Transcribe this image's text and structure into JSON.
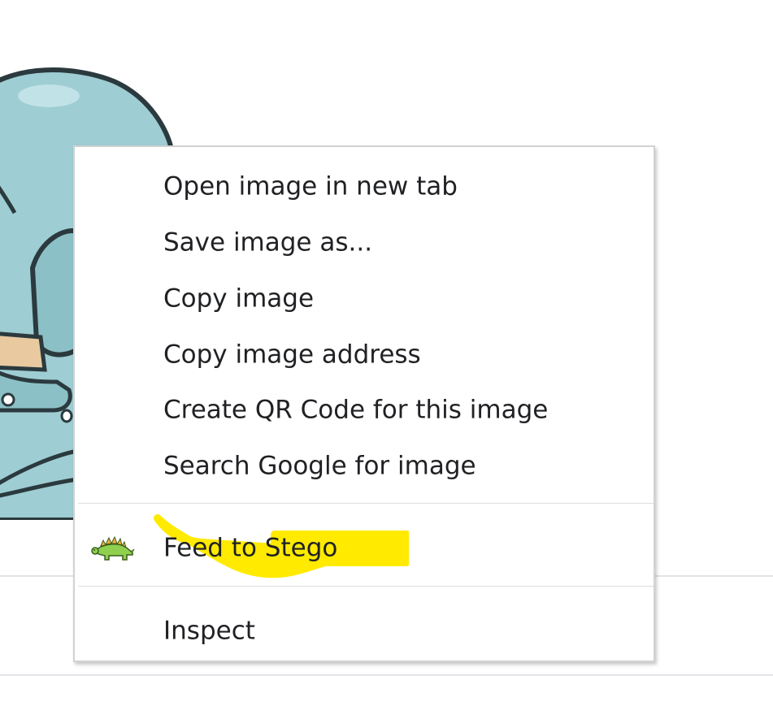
{
  "context_menu": {
    "items": [
      {
        "label": "Open image in new tab"
      },
      {
        "label": "Save image as..."
      },
      {
        "label": "Copy image"
      },
      {
        "label": "Copy image address"
      },
      {
        "label": "Create QR Code for this image"
      },
      {
        "label": "Search Google for image"
      },
      {
        "label": "Feed to Stego",
        "icon": "stegosaurus-icon",
        "highlight_color": "#ffea00"
      },
      {
        "label": "Inspect"
      }
    ]
  },
  "colors": {
    "menu_text": "#202124",
    "menu_border": "#d2d2d2",
    "separator": "#dedede",
    "highlight": "#ffea00",
    "dino_body": "#9ecdd3",
    "dino_outline": "#2b3a3e",
    "dino_belly": "#e9c9a0"
  }
}
